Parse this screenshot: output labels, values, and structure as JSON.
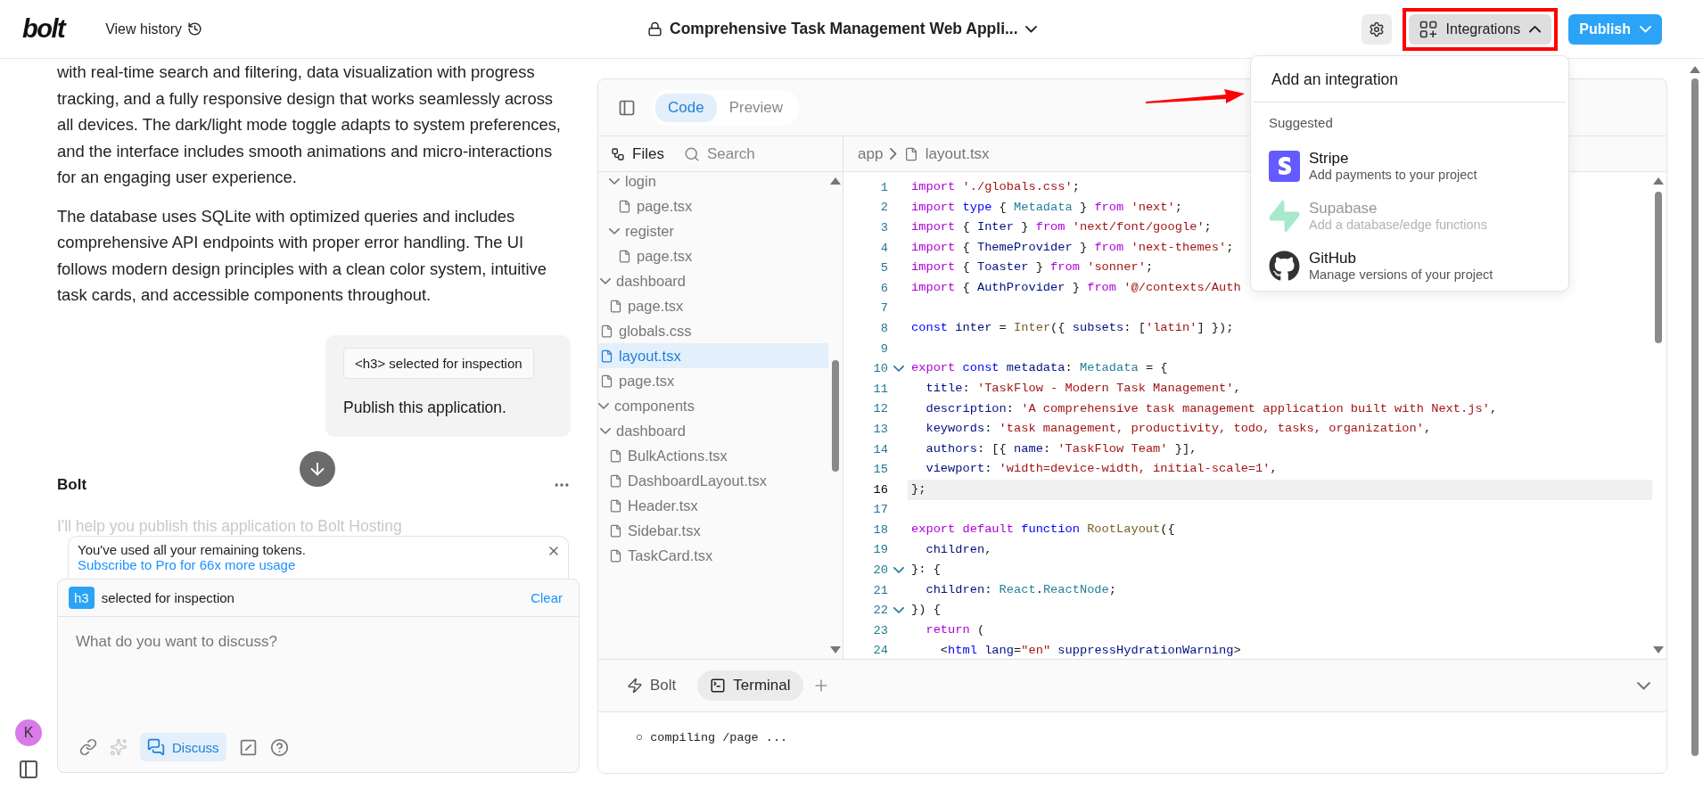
{
  "header": {
    "logo": "bolt",
    "history_label": "View history",
    "project_title": "Comprehensive Task Management Web Appli...",
    "integrations": {
      "label": "Integrations",
      "open": true,
      "highlighted": true
    },
    "publish": "Publish",
    "pointer_arrow": true
  },
  "chat": {
    "paragraphs": [
      "with real-time search and filtering, data visualization with progress tracking, and a fully responsive design that works seamlessly across all devices. The dark/light mode toggle adapts to system preferences, and the interface includes smooth animations and micro-interactions for an engaging user experience.",
      "The database uses SQLite with optimized queries and includes comprehensive API endpoints with proper error handling. The UI follows modern design principles with a clean color system, intuitive task cards, and accessible components throughout."
    ],
    "user_message": {
      "chip": "<h3> selected for inspection",
      "text": "Publish this application."
    },
    "assistant": {
      "name": "Bolt",
      "text": "I'll help you publish this application to Bolt Hosting"
    }
  },
  "notice": {
    "text": "You've used all your remaining tokens.",
    "link": "Subscribe to Pro for 66x more usage"
  },
  "composer": {
    "tag": "h3",
    "tag_text": "selected for inspection",
    "clear": "Clear",
    "placeholder": "What do you want to discuss?",
    "discuss": {
      "label": "Discuss",
      "on": true
    }
  },
  "user": {
    "initial": "K"
  },
  "workbench": {
    "tabs": [
      {
        "label": "Code",
        "selected": true
      },
      {
        "label": "Preview",
        "selected": false
      }
    ],
    "files_label": "Files",
    "search_label": "Search",
    "file_tree": [
      {
        "children": [
          {
            "children": [
              {
                "name": "login",
                "kind": "folder",
                "expanded": true,
                "children": [
                  {
                    "name": "page.tsx",
                    "kind": "file",
                    "selected": false
                  }
                ]
              },
              {
                "name": "register",
                "kind": "folder",
                "expanded": true,
                "children": [
                  {
                    "name": "page.tsx",
                    "kind": "file",
                    "selected": false
                  }
                ]
              }
            ]
          },
          {
            "name": "dashboard",
            "kind": "folder",
            "expanded": true,
            "children": [
              {
                "name": "page.tsx",
                "kind": "file",
                "selected": false
              }
            ]
          },
          {
            "name": "globals.css",
            "kind": "file",
            "selected": false
          },
          {
            "name": "layout.tsx",
            "kind": "file",
            "selected": true
          },
          {
            "name": "page.tsx",
            "kind": "file",
            "selected": false
          }
        ]
      },
      {
        "name": "components",
        "kind": "folder",
        "expanded": true,
        "children": [
          {
            "name": "dashboard",
            "kind": "folder",
            "expanded": true,
            "children": [
              {
                "name": "BulkActions.tsx",
                "kind": "file",
                "selected": false
              },
              {
                "name": "DashboardLayout.tsx",
                "kind": "file",
                "selected": false
              },
              {
                "name": "Header.tsx",
                "kind": "file",
                "selected": false
              },
              {
                "name": "Sidebar.tsx",
                "kind": "file",
                "selected": false
              },
              {
                "name": "TaskCard.tsx",
                "kind": "file",
                "selected": false
              }
            ]
          }
        ]
      }
    ],
    "breadcrumb": [
      "app",
      "layout.tsx"
    ],
    "code_lines": [
      {
        "number": "1",
        "fold": false,
        "current": false,
        "tokens": [
          {
            "text": "import ",
            "color": "#af00db"
          },
          {
            "text": "'./globals.css'",
            "color": "#a31515"
          },
          {
            "text": ";"
          }
        ]
      },
      {
        "number": "2",
        "fold": false,
        "current": false,
        "tokens": [
          {
            "text": "import ",
            "color": "#af00db"
          },
          {
            "text": "type ",
            "color": "#0000ff"
          },
          {
            "text": "{ "
          },
          {
            "text": "Metadata",
            "color": "#267f99"
          },
          {
            "text": " } "
          },
          {
            "text": "from ",
            "color": "#af00db"
          },
          {
            "text": "'next'",
            "color": "#a31515"
          },
          {
            "text": ";"
          }
        ]
      },
      {
        "number": "3",
        "fold": false,
        "current": false,
        "tokens": [
          {
            "text": "import ",
            "color": "#af00db"
          },
          {
            "text": "{ "
          },
          {
            "text": "Inter",
            "color": "#001080"
          },
          {
            "text": " } "
          },
          {
            "text": "from ",
            "color": "#af00db"
          },
          {
            "text": "'next/font/google'",
            "color": "#a31515"
          },
          {
            "text": ";"
          }
        ]
      },
      {
        "number": "4",
        "fold": false,
        "current": false,
        "tokens": [
          {
            "text": "import ",
            "color": "#af00db"
          },
          {
            "text": "{ "
          },
          {
            "text": "ThemeProvider",
            "color": "#001080"
          },
          {
            "text": " } "
          },
          {
            "text": "from ",
            "color": "#af00db"
          },
          {
            "text": "'next-themes'",
            "color": "#a31515"
          },
          {
            "text": ";"
          }
        ]
      },
      {
        "number": "5",
        "fold": false,
        "current": false,
        "tokens": [
          {
            "text": "import ",
            "color": "#af00db"
          },
          {
            "text": "{ "
          },
          {
            "text": "Toaster",
            "color": "#001080"
          },
          {
            "text": " } "
          },
          {
            "text": "from ",
            "color": "#af00db"
          },
          {
            "text": "'sonner'",
            "color": "#a31515"
          },
          {
            "text": ";"
          }
        ]
      },
      {
        "number": "6",
        "fold": false,
        "current": false,
        "tokens": [
          {
            "text": "import ",
            "color": "#af00db"
          },
          {
            "text": "{ "
          },
          {
            "text": "AuthProvider",
            "color": "#001080"
          },
          {
            "text": " } "
          },
          {
            "text": "from ",
            "color": "#af00db"
          },
          {
            "text": "'@/contexts/Auth",
            "color": "#a31515"
          }
        ]
      },
      {
        "number": "7",
        "fold": false,
        "current": false
      },
      {
        "number": "8",
        "fold": false,
        "current": false,
        "tokens": [
          {
            "text": "const ",
            "color": "#0000ff"
          },
          {
            "text": "inter",
            "color": "#001080"
          },
          {
            "text": " = "
          },
          {
            "text": "Inter",
            "color": "#795e26"
          },
          {
            "text": "({ "
          },
          {
            "text": "subsets",
            "color": "#001080"
          },
          {
            "text": ": ["
          },
          {
            "text": "'latin'",
            "color": "#a31515"
          },
          {
            "text": "] });"
          }
        ]
      },
      {
        "number": "9",
        "fold": false,
        "current": false
      },
      {
        "number": "10",
        "fold": true,
        "current": false,
        "tokens": [
          {
            "text": "export ",
            "color": "#af00db"
          },
          {
            "text": "const ",
            "color": "#0000ff"
          },
          {
            "text": "metadata",
            "color": "#001080"
          },
          {
            "text": ": "
          },
          {
            "text": "Metadata",
            "color": "#267f99"
          },
          {
            "text": " = {"
          }
        ]
      },
      {
        "number": "11",
        "fold": false,
        "current": false,
        "tokens": [
          {
            "text": "  title",
            "color": "#001080"
          },
          {
            "text": ": "
          },
          {
            "text": "'TaskFlow - Modern Task Management'",
            "color": "#a31515"
          },
          {
            "text": ","
          }
        ]
      },
      {
        "number": "12",
        "fold": false,
        "current": false,
        "tokens": [
          {
            "text": "  description",
            "color": "#001080"
          },
          {
            "text": ": "
          },
          {
            "text": "'A comprehensive task management application built with Next.js'",
            "color": "#a31515"
          },
          {
            "text": ","
          }
        ]
      },
      {
        "number": "13",
        "fold": false,
        "current": false,
        "tokens": [
          {
            "text": "  keywords",
            "color": "#001080"
          },
          {
            "text": ": "
          },
          {
            "text": "'task management, productivity, todo, tasks, organization'",
            "color": "#a31515"
          },
          {
            "text": ","
          }
        ]
      },
      {
        "number": "14",
        "fold": false,
        "current": false,
        "tokens": [
          {
            "text": "  authors",
            "color": "#001080"
          },
          {
            "text": ": [{ "
          },
          {
            "text": "name",
            "color": "#001080"
          },
          {
            "text": ": "
          },
          {
            "text": "'TaskFlow Team'",
            "color": "#a31515"
          },
          {
            "text": " }],"
          }
        ]
      },
      {
        "number": "15",
        "fold": false,
        "current": false,
        "tokens": [
          {
            "text": "  viewport",
            "color": "#001080"
          },
          {
            "text": ": "
          },
          {
            "text": "'width=device-width, initial-scale=1'",
            "color": "#a31515"
          },
          {
            "text": ","
          }
        ]
      },
      {
        "number": "16",
        "fold": false,
        "current": true,
        "tokens": [
          {
            "text": "};"
          }
        ]
      },
      {
        "number": "17",
        "fold": false,
        "current": false
      },
      {
        "number": "18",
        "fold": false,
        "current": false,
        "tokens": [
          {
            "text": "export default ",
            "color": "#af00db"
          },
          {
            "text": "function ",
            "color": "#0000ff"
          },
          {
            "text": "RootLayout",
            "color": "#795e26"
          },
          {
            "text": "({"
          }
        ]
      },
      {
        "number": "19",
        "fold": false,
        "current": false,
        "tokens": [
          {
            "text": "  children",
            "color": "#001080"
          },
          {
            "text": ","
          }
        ]
      },
      {
        "number": "20",
        "fold": true,
        "current": false,
        "tokens": [
          {
            "text": "}: {"
          }
        ]
      },
      {
        "number": "21",
        "fold": false,
        "current": false,
        "tokens": [
          {
            "text": "  children",
            "color": "#001080"
          },
          {
            "text": ": "
          },
          {
            "text": "React",
            "color": "#267f99"
          },
          {
            "text": "."
          },
          {
            "text": "ReactNode",
            "color": "#267f99"
          },
          {
            "text": ";"
          }
        ]
      },
      {
        "number": "22",
        "fold": true,
        "current": false,
        "tokens": [
          {
            "text": "}) {"
          }
        ]
      },
      {
        "number": "23",
        "fold": false,
        "current": false,
        "tokens": [
          {
            "text": "  return",
            "color": "#af00db"
          },
          {
            "text": " ("
          }
        ]
      },
      {
        "number": "24",
        "fold": false,
        "current": false,
        "tokens": [
          {
            "text": "    <"
          },
          {
            "text": "html",
            "color": "#0000ff"
          },
          {
            "text": " lang",
            "color": "#001080"
          },
          {
            "text": "="
          },
          {
            "text": "\"en\"",
            "color": "#a31515"
          },
          {
            "text": " suppressHydrationWarning",
            "color": "#001080"
          },
          {
            "text": ">"
          }
        ]
      }
    ],
    "bottom_tabs": [
      {
        "label": "Bolt",
        "kind": "bolt",
        "selected": false
      },
      {
        "label": "Terminal",
        "kind": "terminal",
        "selected": true
      }
    ],
    "terminal_line": "○ compiling /page ..."
  },
  "integrations_menu": {
    "title": "Add an integration",
    "section": "Suggested",
    "items": [
      {
        "name": "Stripe",
        "description": "Add payments to your project",
        "kind": "stripe",
        "disabled": false
      },
      {
        "name": "Supabase",
        "description": "Add a database/edge functions",
        "kind": "supabase",
        "disabled": true
      },
      {
        "name": "GitHub",
        "description": "Manage versions of your project",
        "kind": "github",
        "disabled": false
      }
    ]
  }
}
